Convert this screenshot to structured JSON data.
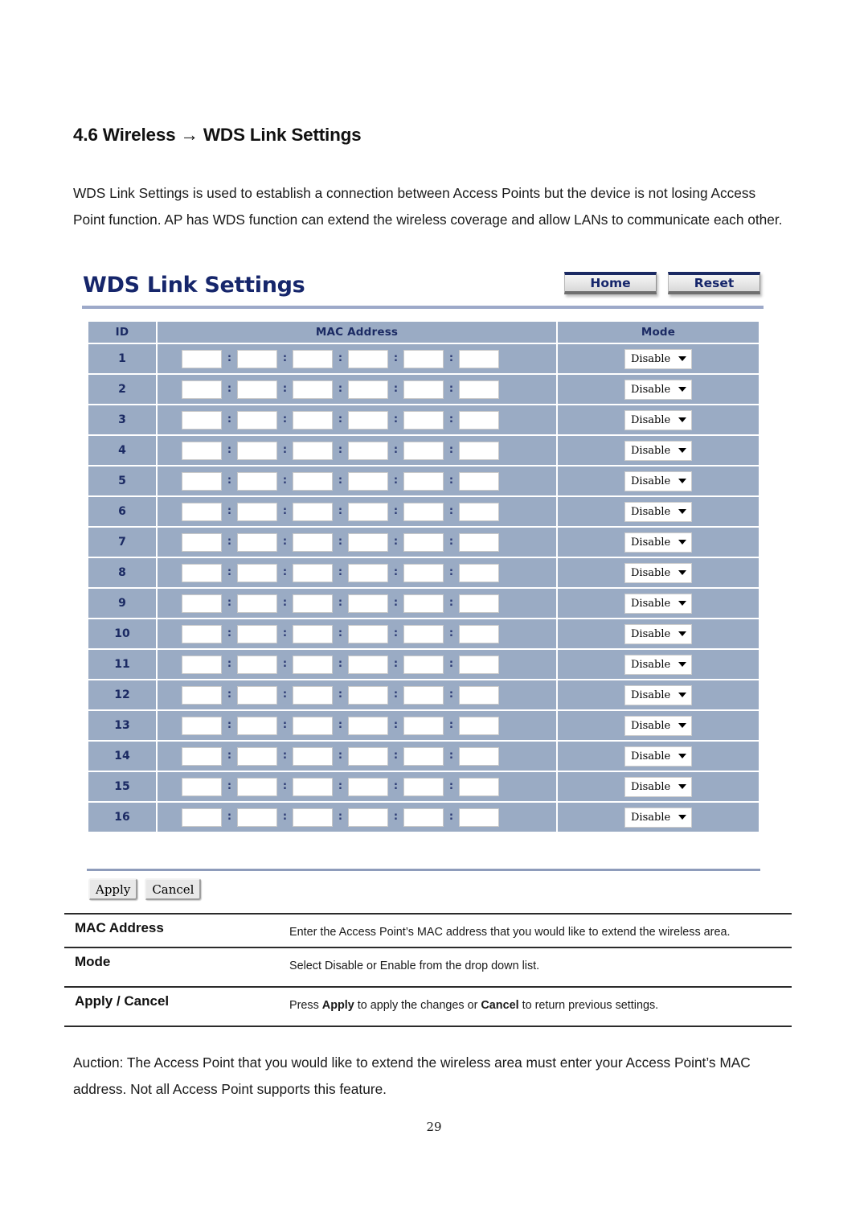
{
  "document": {
    "section_title": "4.6 Wireless → WDS Link Settings",
    "intro_paragraph": "WDS Link Settings is used to establish a connection between Access Points but the device is not losing Access Point function. AP has WDS function can extend the wireless coverage and allow LANs to communicate each other.",
    "note_paragraph": "Auction: The Access Point that you would like to extend the wireless area must enter your Access Point’s MAC address. Not all Access Point supports this feature.",
    "page_number": "29"
  },
  "ui_panel": {
    "title": "WDS Link Settings",
    "nav_buttons": [
      {
        "label": "Home",
        "name": "home-button"
      },
      {
        "label": "Reset",
        "name": "reset-button"
      }
    ],
    "table": {
      "headers": [
        "ID",
        "MAC Address",
        "Mode"
      ],
      "mac_separator": ":",
      "mac_octet_count": 6,
      "mac_placeholder": "",
      "rows": [
        {
          "id": "1",
          "mac": [
            "",
            "",
            "",
            "",
            "",
            ""
          ],
          "mode": "Disable"
        },
        {
          "id": "2",
          "mac": [
            "",
            "",
            "",
            "",
            "",
            ""
          ],
          "mode": "Disable"
        },
        {
          "id": "3",
          "mac": [
            "",
            "",
            "",
            "",
            "",
            ""
          ],
          "mode": "Disable"
        },
        {
          "id": "4",
          "mac": [
            "",
            "",
            "",
            "",
            "",
            ""
          ],
          "mode": "Disable"
        },
        {
          "id": "5",
          "mac": [
            "",
            "",
            "",
            "",
            "",
            ""
          ],
          "mode": "Disable"
        },
        {
          "id": "6",
          "mac": [
            "",
            "",
            "",
            "",
            "",
            ""
          ],
          "mode": "Disable"
        },
        {
          "id": "7",
          "mac": [
            "",
            "",
            "",
            "",
            "",
            ""
          ],
          "mode": "Disable"
        },
        {
          "id": "8",
          "mac": [
            "",
            "",
            "",
            "",
            "",
            ""
          ],
          "mode": "Disable"
        },
        {
          "id": "9",
          "mac": [
            "",
            "",
            "",
            "",
            "",
            ""
          ],
          "mode": "Disable"
        },
        {
          "id": "10",
          "mac": [
            "",
            "",
            "",
            "",
            "",
            ""
          ],
          "mode": "Disable"
        },
        {
          "id": "11",
          "mac": [
            "",
            "",
            "",
            "",
            "",
            ""
          ],
          "mode": "Disable"
        },
        {
          "id": "12",
          "mac": [
            "",
            "",
            "",
            "",
            "",
            ""
          ],
          "mode": "Disable"
        },
        {
          "id": "13",
          "mac": [
            "",
            "",
            "",
            "",
            "",
            ""
          ],
          "mode": "Disable"
        },
        {
          "id": "14",
          "mac": [
            "",
            "",
            "",
            "",
            "",
            ""
          ],
          "mode": "Disable"
        },
        {
          "id": "15",
          "mac": [
            "",
            "",
            "",
            "",
            "",
            ""
          ],
          "mode": "Disable"
        },
        {
          "id": "16",
          "mac": [
            "",
            "",
            "",
            "",
            "",
            ""
          ],
          "mode": "Disable"
        }
      ]
    },
    "mode_options": [
      "Disable",
      "Enable"
    ],
    "form_actions": [
      {
        "label": "Apply",
        "name": "apply-button"
      },
      {
        "label": "Cancel",
        "name": "cancel-button"
      }
    ]
  },
  "description_table": {
    "rows": [
      {
        "label": "MAC Address",
        "text": "Enter the Access Point’s MAC address that you would like to extend the wireless area."
      },
      {
        "label": "Mode",
        "text": "Select Disable or Enable from the drop down list."
      },
      {
        "label": "Apply / Cancel",
        "text_parts": {
          "pre": "Press ",
          "bold1": "Apply",
          "mid": " to apply the changes or ",
          "bold2": "Cancel",
          "post": " to return previous settings."
        }
      }
    ]
  },
  "colors": {
    "table_cell_bg": "#9aabc4",
    "heading_navy": "#16266b",
    "rule_blue": "#9da9c9"
  }
}
